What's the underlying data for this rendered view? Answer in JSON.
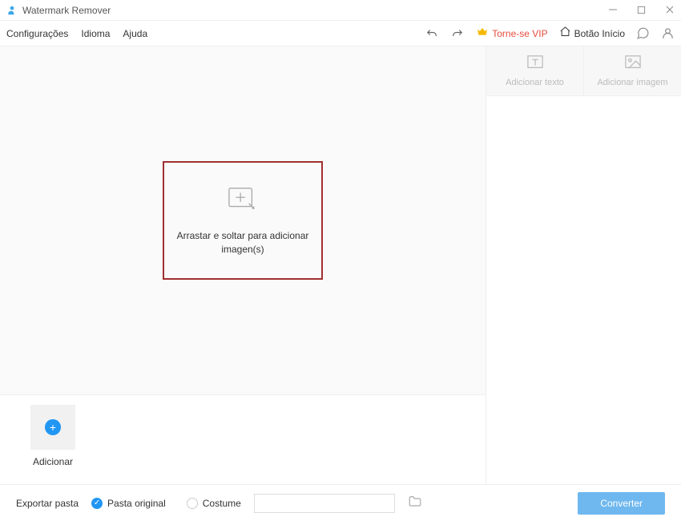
{
  "titlebar": {
    "app_name": "Watermark Remover"
  },
  "menu": {
    "config": "Configurações",
    "language": "Idioma",
    "help": "Ajuda",
    "vip": "Torne-se VIP",
    "home": "Botão Início"
  },
  "drop": {
    "text": "Arrastar e soltar para adicionar imagen(s)"
  },
  "thumb": {
    "add": "Adicionar"
  },
  "tabs": {
    "text": "Adicionar texto",
    "image": "Adicionar imagem"
  },
  "footer": {
    "export_label": "Exportar pasta",
    "original": "Pasta original",
    "custom": "Costume",
    "path": "",
    "convert": "Converter"
  }
}
